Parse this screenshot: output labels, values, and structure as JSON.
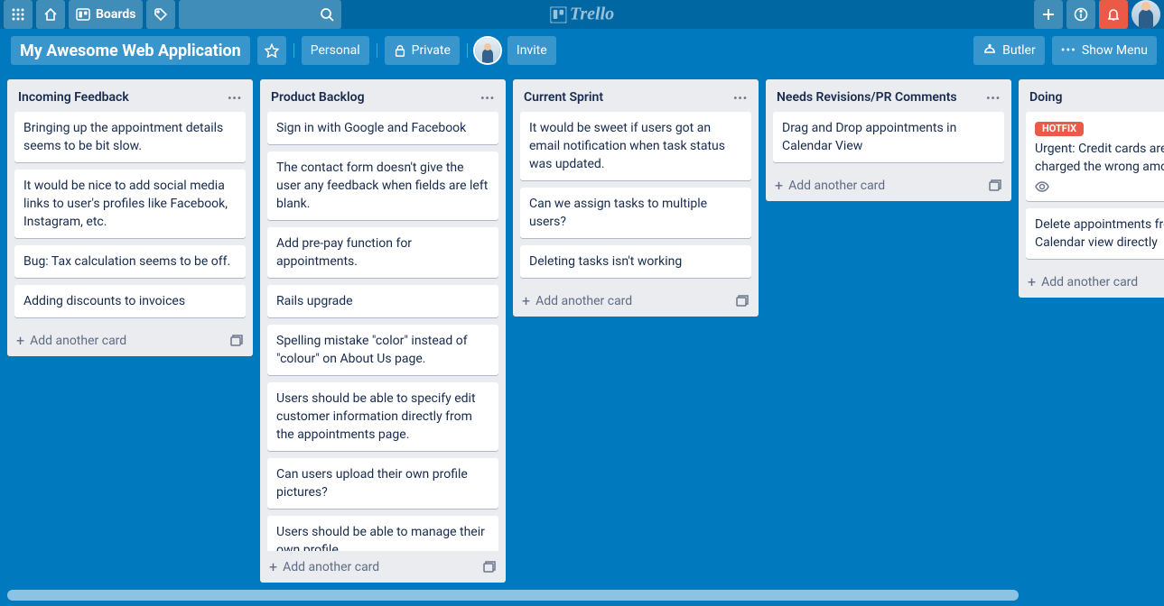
{
  "header": {
    "boards_label": "Boards",
    "logo_text": "Trello"
  },
  "board": {
    "name": "My Awesome Web Application",
    "team_label": "Personal",
    "visibility_label": "Private",
    "invite_label": "Invite",
    "butler_label": "Butler",
    "show_menu_label": "Show Menu"
  },
  "add_card_label": "Add another card",
  "labels": {
    "hotfix": {
      "text": "HOTFIX",
      "color": "#eb5a46"
    }
  },
  "lists": [
    {
      "title": "Incoming Feedback",
      "cards": [
        {
          "text": "Bringing up the appointment details seems to be bit slow."
        },
        {
          "text": "It would be nice to add social media links to user's profiles like Facebook, Instagram, etc."
        },
        {
          "text": "Bug: Tax calculation seems to be off."
        },
        {
          "text": "Adding discounts to invoices"
        }
      ]
    },
    {
      "title": "Product Backlog",
      "cards": [
        {
          "text": "Sign in with Google and Facebook"
        },
        {
          "text": "The contact form doesn't give the user any feedback when fields are left blank."
        },
        {
          "text": "Add pre-pay function for appointments."
        },
        {
          "text": "Rails upgrade"
        },
        {
          "text": "Spelling mistake \"color\" instead of \"colour\" on About Us page."
        },
        {
          "text": "Users should be able to specify edit customer information directly from the appointments page."
        },
        {
          "text": "Can users upload their own profile pictures?"
        },
        {
          "text": "Users should be able to manage their own profile."
        }
      ]
    },
    {
      "title": "Current Sprint",
      "cards": [
        {
          "text": "It would be sweet if users got an email notification when task status was updated."
        },
        {
          "text": "Can we assign tasks to multiple users?"
        },
        {
          "text": "Deleting tasks isn't working"
        }
      ]
    },
    {
      "title": "Needs Revisions/PR Comments",
      "cards": [
        {
          "text": "Drag and Drop appointments in Calendar View"
        }
      ]
    },
    {
      "title": "Doing",
      "cards": [
        {
          "label": "hotfix",
          "text": "Urgent: Credit cards are being charged the wrong amount",
          "watch": true
        },
        {
          "text": "Delete appointments from the Calendar view directly"
        }
      ]
    }
  ]
}
